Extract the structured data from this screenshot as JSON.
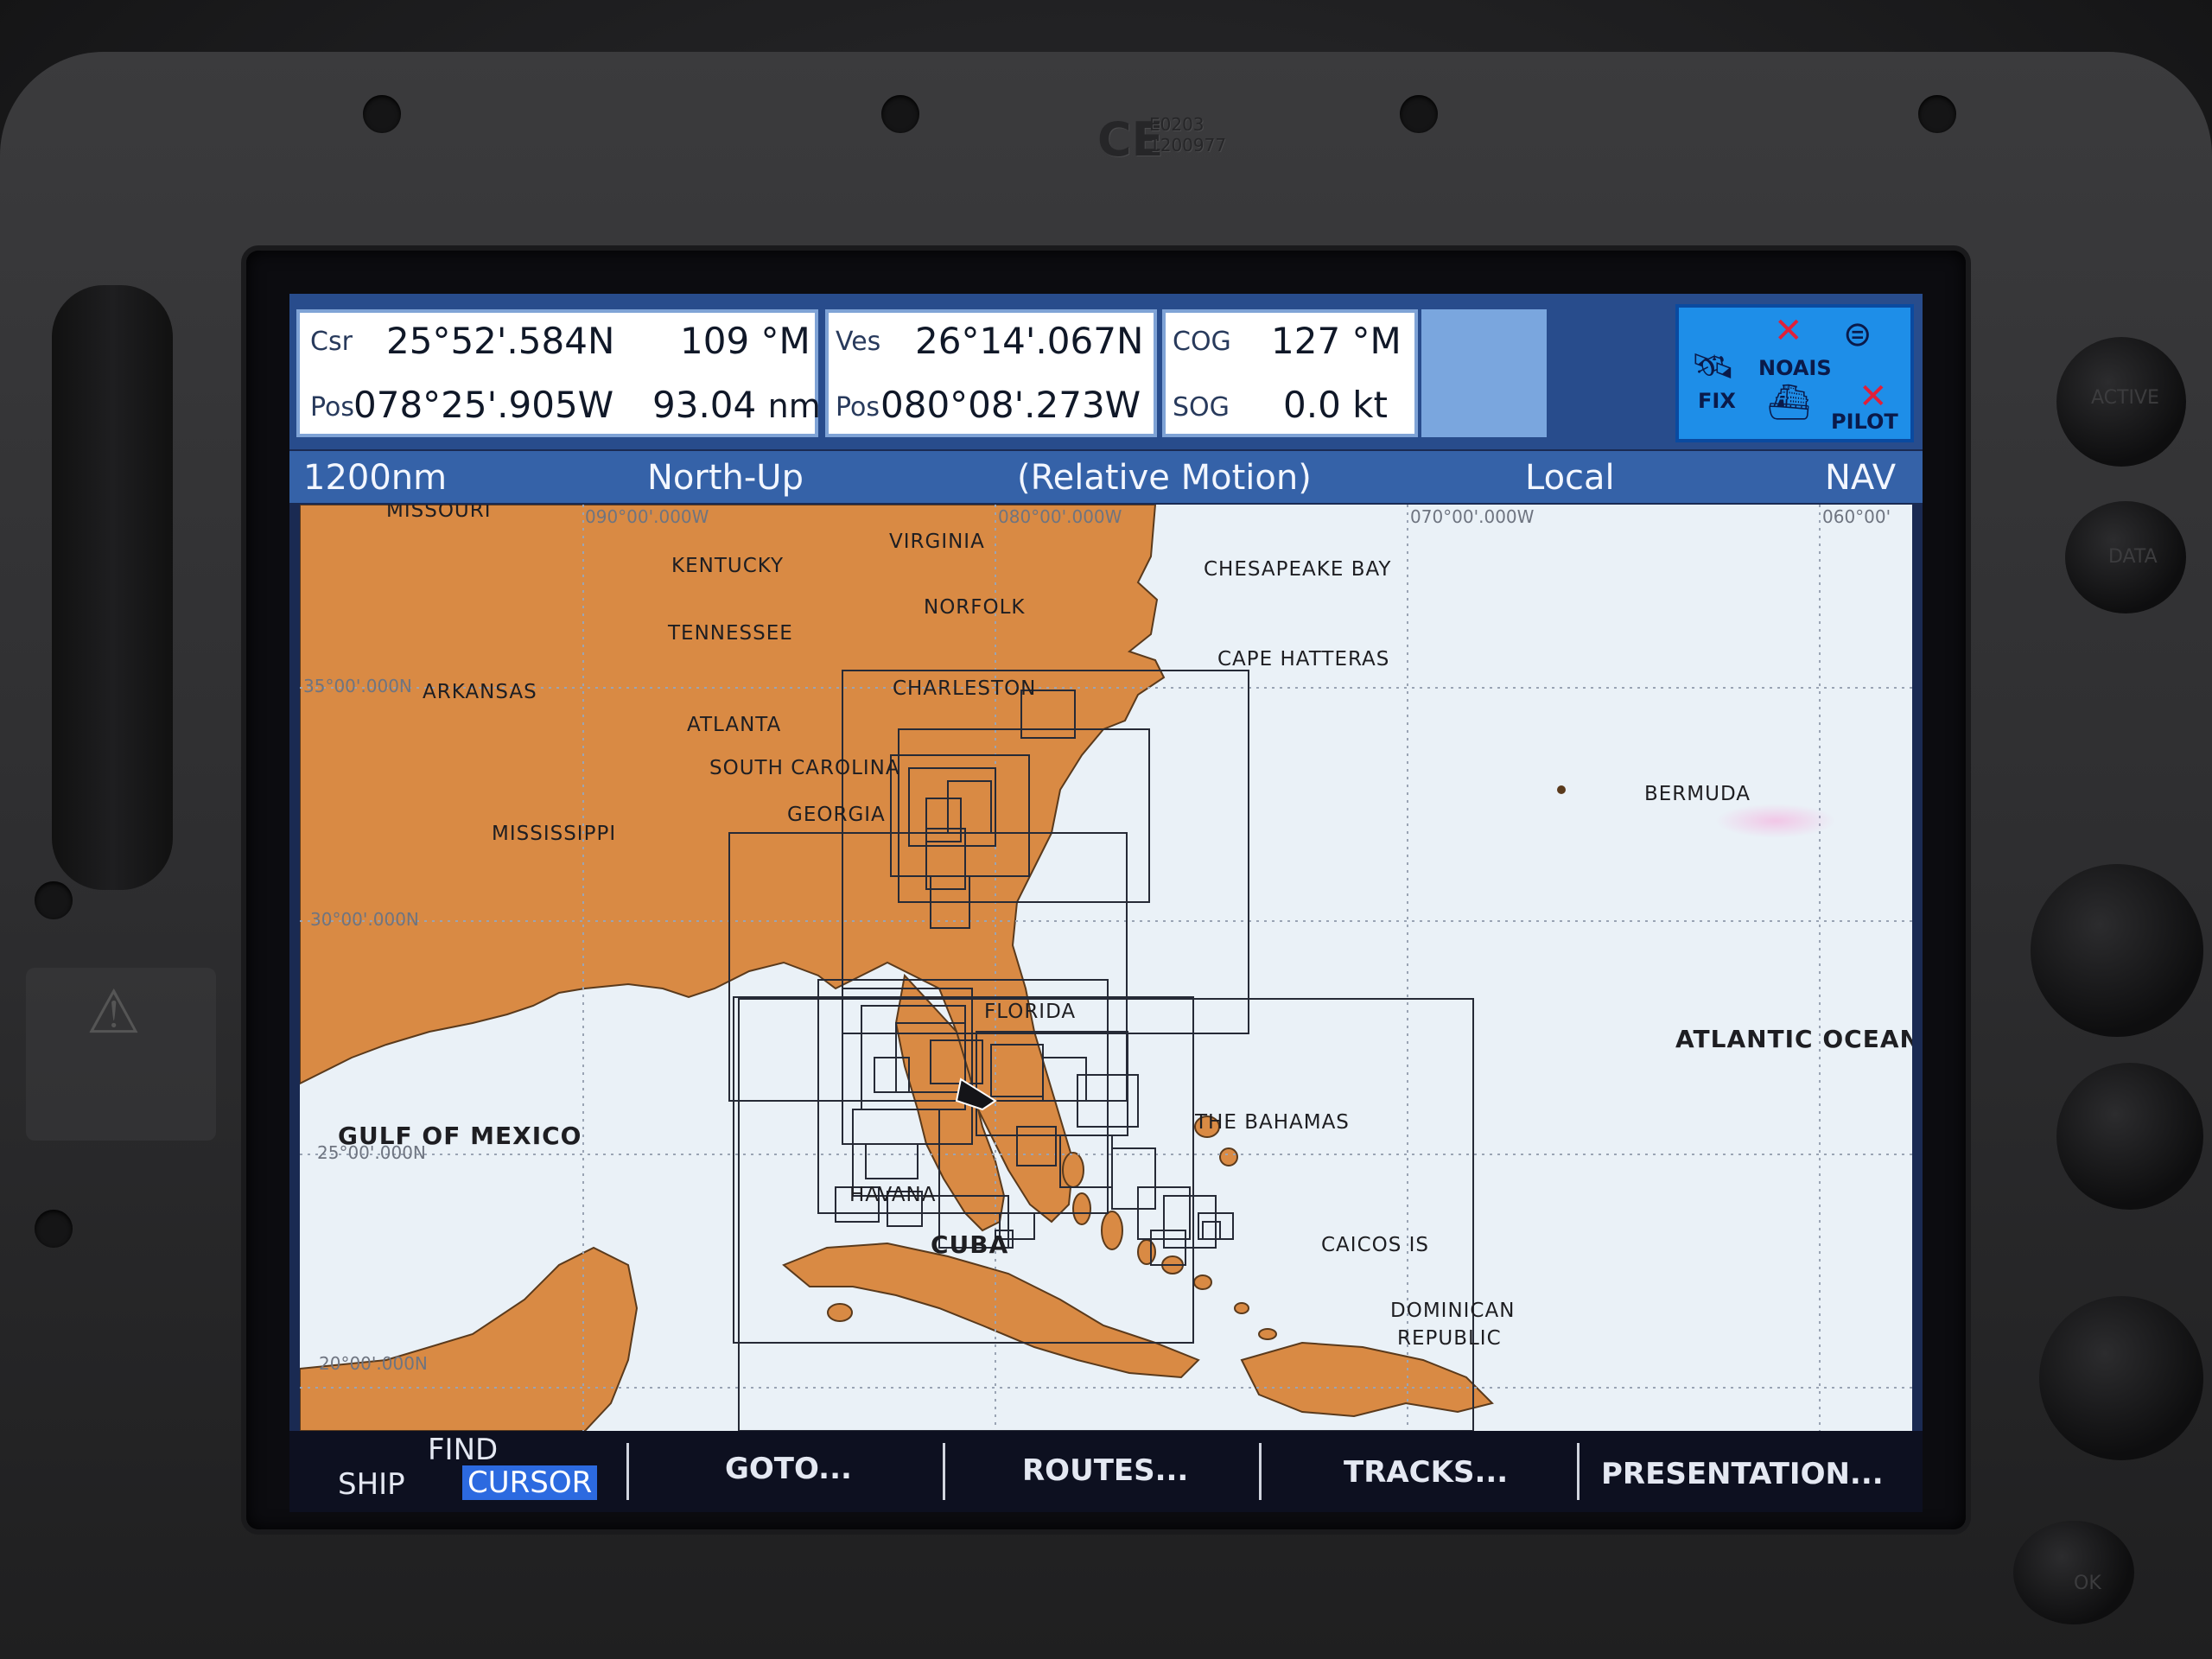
{
  "device": {
    "ce_mark": "CE",
    "ce_code_1": "E0203",
    "ce_code_2": "1200977",
    "right_button_1": "ACTIVE",
    "right_button_2": "DATA",
    "right_button_3": "OK"
  },
  "data_panel": {
    "cursor": {
      "label_top": "Csr",
      "label_bottom": "Pos",
      "lat": "25°52'.584N",
      "lon": "078°25'.905W",
      "bearing": "109 °M",
      "range": "93.04",
      "range_unit": "nm"
    },
    "vessel": {
      "label_top": "Ves",
      "label_bottom": "Pos",
      "lat": "26°14'.067N",
      "lon": "080°08'.273W"
    },
    "course": {
      "cog_label": "COG",
      "cog_value": "127 °M",
      "sog_label": "SOG",
      "sog_value": "0.0 kt"
    },
    "status_icons": {
      "fix": "FIX",
      "noais": "NOAIS",
      "pilot": "PILOT"
    }
  },
  "title_bar": {
    "range": "1200nm",
    "orientation": "North-Up",
    "motion": "(Relative Motion)",
    "time": "Local",
    "mode": "NAV"
  },
  "chart": {
    "grid_labels": {
      "lon_090": "090°00'.000W",
      "lon_080": "080°00'.000W",
      "lon_070": "070°00'.000W",
      "lon_060": "060°00'",
      "lat_35": "35°00'.000N",
      "lat_30": "30°00'.000N",
      "lat_25": "25°00'.000N",
      "lat_20": "20°00'.000N"
    },
    "places": {
      "missouri": "MISSOURI",
      "kentucky": "KENTUCKY",
      "virginia": "VIRGINIA",
      "norfolk": "NORFOLK",
      "chesapeake": "CHESAPEAKE BAY",
      "tennessee": "TENNESSEE",
      "hatteras": "CAPE HATTERAS",
      "arkansas": "ARKANSAS",
      "charleston": "CHARLESTON",
      "atlanta": "ATLANTA",
      "south_carolina": "SOUTH CAROLINA",
      "georgia": "GEORGIA",
      "mississippi": "MISSISSIPPI",
      "bermuda": "BERMUDA",
      "florida": "FLORIDA",
      "atlantic": "ATLANTIC OCEAN",
      "bahamas": "THE BAHAMAS",
      "gulf": "GULF OF MEXICO",
      "havana": "HAVANA",
      "caicos": "CAICOS IS",
      "cuba": "CUBA",
      "dominican_1": "DOMINICAN",
      "dominican_2": "REPUBLIC"
    }
  },
  "softkeys": {
    "find_top": "FIND",
    "find_ship": "SHIP",
    "find_cursor": "CURSOR",
    "goto": "GOTO...",
    "routes": "ROUTES...",
    "tracks": "TRACKS...",
    "presentation": "PRESENTATION..."
  },
  "colors": {
    "land": "#d98a44",
    "sea": "#eaf1f7",
    "header_blue": "#284c8c",
    "softkey_selected": "#2c6ae0"
  }
}
